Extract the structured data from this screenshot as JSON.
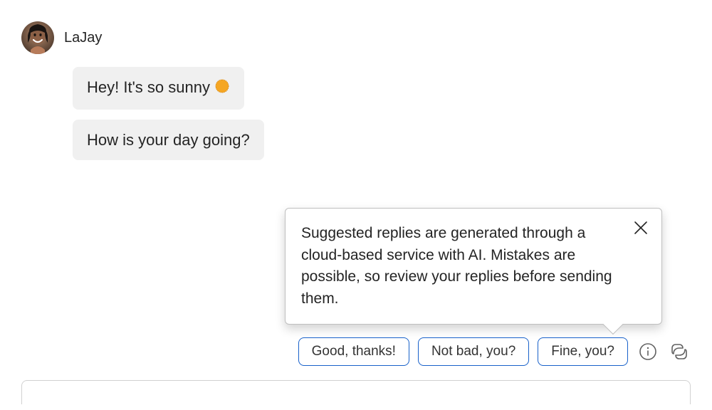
{
  "sender": {
    "name": "LaJay"
  },
  "messages": [
    {
      "text": "Hey! It's so sunny ",
      "sun": true
    },
    {
      "text": "How is your day going?",
      "sun": false
    }
  ],
  "tooltip": {
    "text": "Suggested replies are generated through a cloud-based service with AI. Mistakes are possible, so review your replies before sending them."
  },
  "suggestedReplies": [
    "Good, thanks!",
    "Not bad, you?",
    "Fine, you?"
  ]
}
